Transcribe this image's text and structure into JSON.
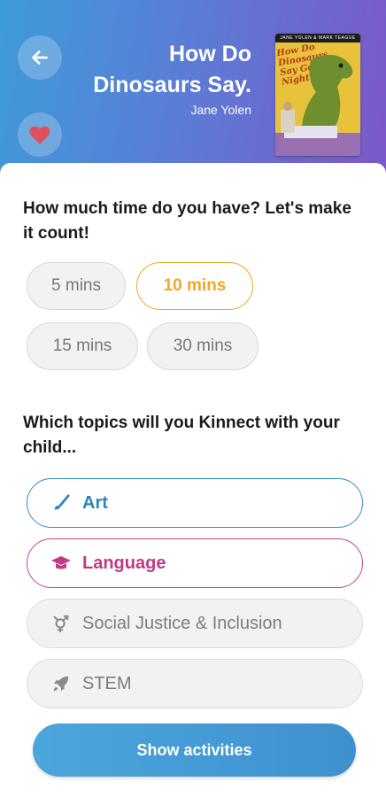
{
  "header": {
    "title_line1": "How Do",
    "title_line2": "Dinosaurs Say.",
    "author": "Jane Yolen",
    "back_icon": "arrow-left-icon",
    "favorite_icon": "heart-icon"
  },
  "cover": {
    "top_text": "JANE YOLEN & MARK TEAGUE",
    "title": "How Do Dinosaurs Say Good Night?"
  },
  "time_question": "How much time do you have? Let's make it count!",
  "time_options": [
    "5 mins",
    "10 mins",
    "15 mins",
    "30 mins"
  ],
  "time_selected": "10 mins",
  "topic_question": "Which topics will you Kinnect with your child...",
  "topics": [
    {
      "label": "Art",
      "icon": "paintbrush-icon",
      "color": "#2a86b9",
      "selected": true
    },
    {
      "label": "Language",
      "icon": "graduation-cap-icon",
      "color": "#c03a85",
      "selected": true
    },
    {
      "label": "Social Justice & Inclusion",
      "icon": "gender-symbols-icon",
      "color": "#7d7d7d",
      "selected": false
    },
    {
      "label": "STEM",
      "icon": "rocket-icon",
      "color": "#7d7d7d",
      "selected": false
    }
  ],
  "cta_label": "Show activities",
  "colors": {
    "accent_orange": "#f5a623",
    "header_start": "#3d9bd8",
    "header_end": "#7c58c9",
    "button": "#3f90ce"
  }
}
